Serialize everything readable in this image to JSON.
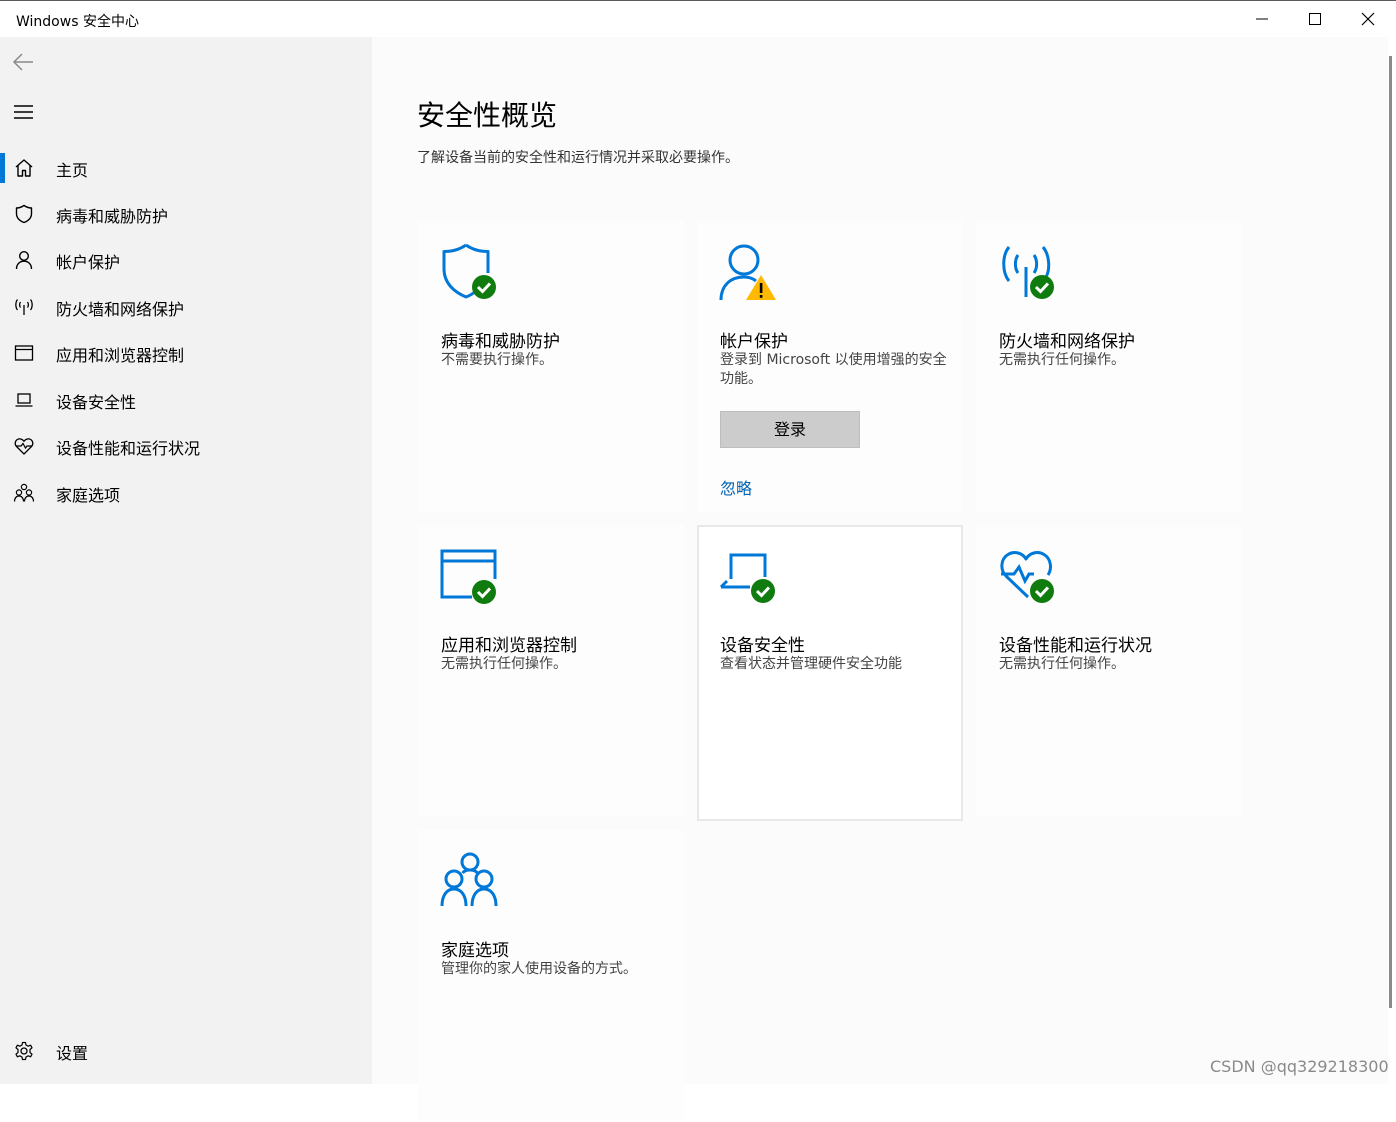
{
  "window": {
    "title": "Windows 安全中心"
  },
  "sidebar": {
    "items": [
      {
        "label": "主页",
        "icon": "home-icon",
        "active": true
      },
      {
        "label": "病毒和威胁防护",
        "icon": "shield-icon"
      },
      {
        "label": "帐户保护",
        "icon": "person-icon"
      },
      {
        "label": "防火墙和网络保护",
        "icon": "antenna-icon"
      },
      {
        "label": "应用和浏览器控制",
        "icon": "browser-window-icon"
      },
      {
        "label": "设备安全性",
        "icon": "laptop-icon"
      },
      {
        "label": "设备性能和运行状况",
        "icon": "heart-pulse-icon"
      },
      {
        "label": "家庭选项",
        "icon": "family-icon"
      }
    ],
    "settings_label": "设置"
  },
  "main": {
    "title": "安全性概览",
    "subtitle": "了解设备当前的安全性和运行情况并采取必要操作。",
    "tiles": [
      {
        "title": "病毒和威胁防护",
        "desc": "不需要执行操作。",
        "status": "ok",
        "icon": "shield-icon"
      },
      {
        "title": "帐户保护",
        "desc": "登录到 Microsoft 以使用增强的安全功能。",
        "status": "warning",
        "icon": "person-icon",
        "action_label": "登录",
        "link_label": "忽略"
      },
      {
        "title": "防火墙和网络保护",
        "desc": "无需执行任何操作。",
        "status": "ok",
        "icon": "antenna-icon"
      },
      {
        "title": "应用和浏览器控制",
        "desc": "无需执行任何操作。",
        "status": "ok",
        "icon": "browser-window-icon"
      },
      {
        "title": "设备安全性",
        "desc": "查看状态并管理硬件安全功能",
        "status": "ok",
        "icon": "laptop-icon"
      },
      {
        "title": "设备性能和运行状况",
        "desc": "无需执行任何操作。",
        "status": "ok",
        "icon": "heart-pulse-icon"
      },
      {
        "title": "家庭选项",
        "desc": "管理你的家人使用设备的方式。",
        "status": "none",
        "icon": "family-icon"
      }
    ]
  },
  "watermark": "CSDN @qq329218300",
  "colors": {
    "accent": "#0078d7",
    "ok": "#107c10",
    "warning": "#ffb900",
    "sidebar_bg": "#f2f2f2",
    "link": "#0063b1"
  }
}
